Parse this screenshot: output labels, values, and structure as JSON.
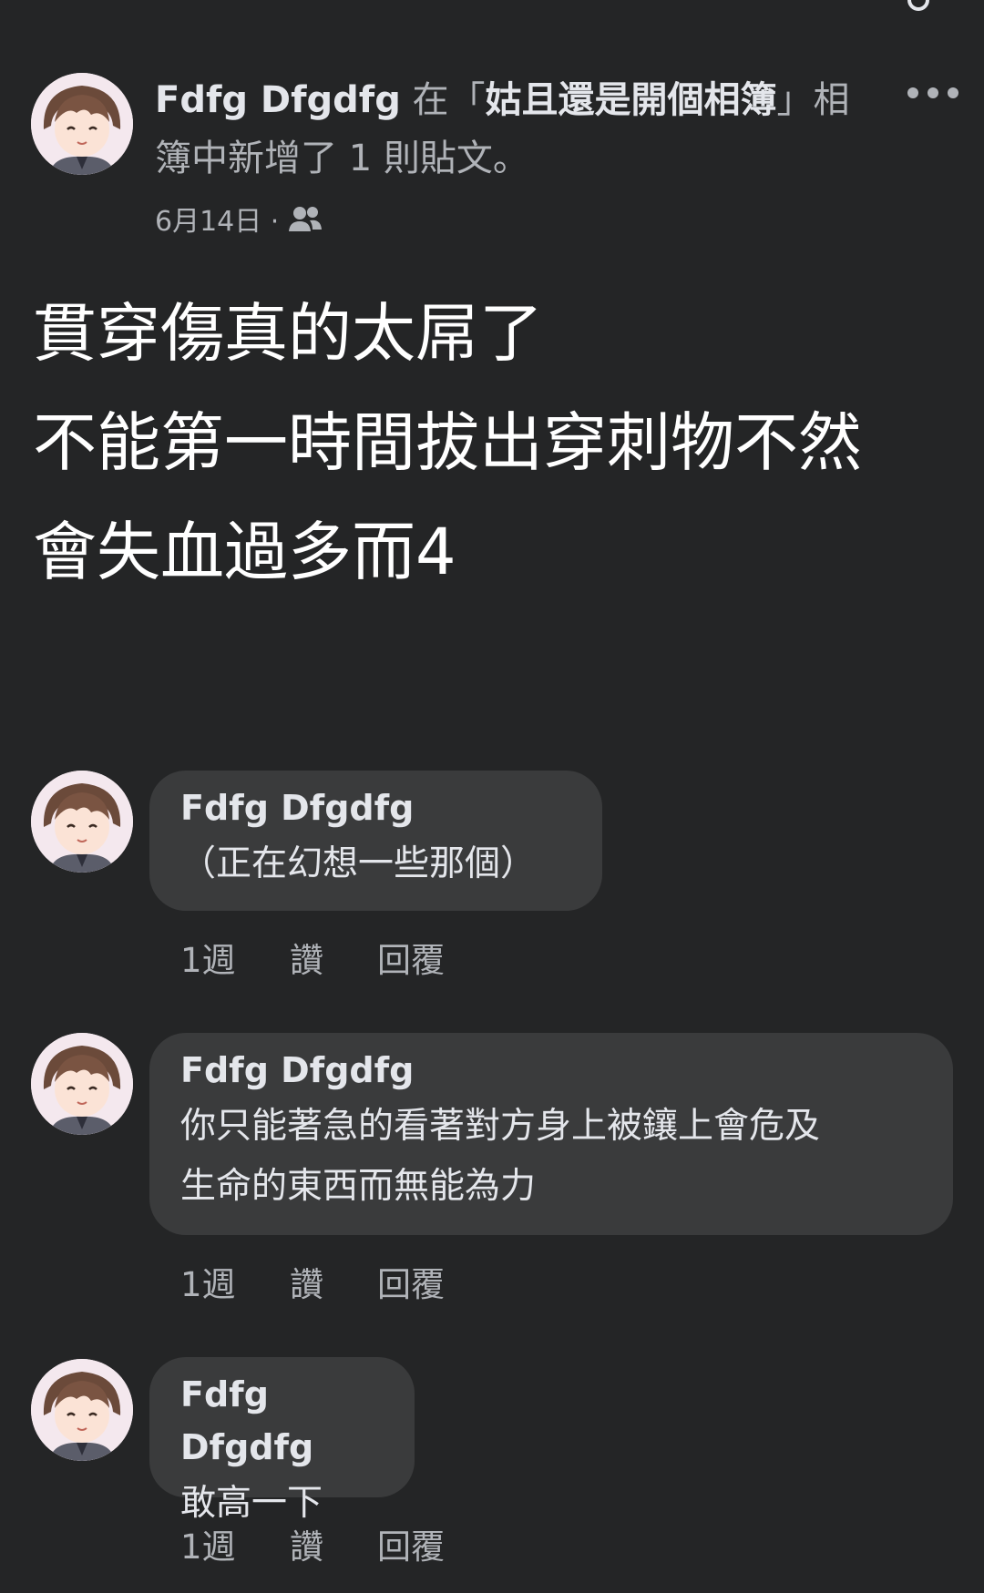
{
  "post": {
    "author": "Fdfg Dfgdfg",
    "header_in": " 在「",
    "album": "姑且還是開個相簿",
    "header_rest": "」相簿中新增了 1 則貼文。",
    "date": "6月14日 ·",
    "privacy_icon": "friends-icon",
    "body": "貫穿傷真的太屌了\n不能第一時間拔出穿刺物不然\n會失血過多而4"
  },
  "comments": [
    {
      "author": "Fdfg Dfgdfg",
      "text": "（正在幻想一些那個）",
      "time": "1週",
      "like": "讚",
      "reply": "回覆"
    },
    {
      "author": "Fdfg Dfgdfg",
      "text": "你只能著急的看著對方身上被鑲上會危及\n生命的東西而無能為力",
      "time": "1週",
      "like": "讚",
      "reply": "回覆"
    },
    {
      "author": "Fdfg Dfgdfg",
      "text": "敢高一下",
      "time": "1週",
      "like": "讚",
      "reply": "回覆"
    }
  ],
  "colors": {
    "background": "#242526",
    "bubble": "#3a3b3c",
    "primary_text": "#e4e6eb",
    "secondary_text": "#b0b3b8"
  }
}
